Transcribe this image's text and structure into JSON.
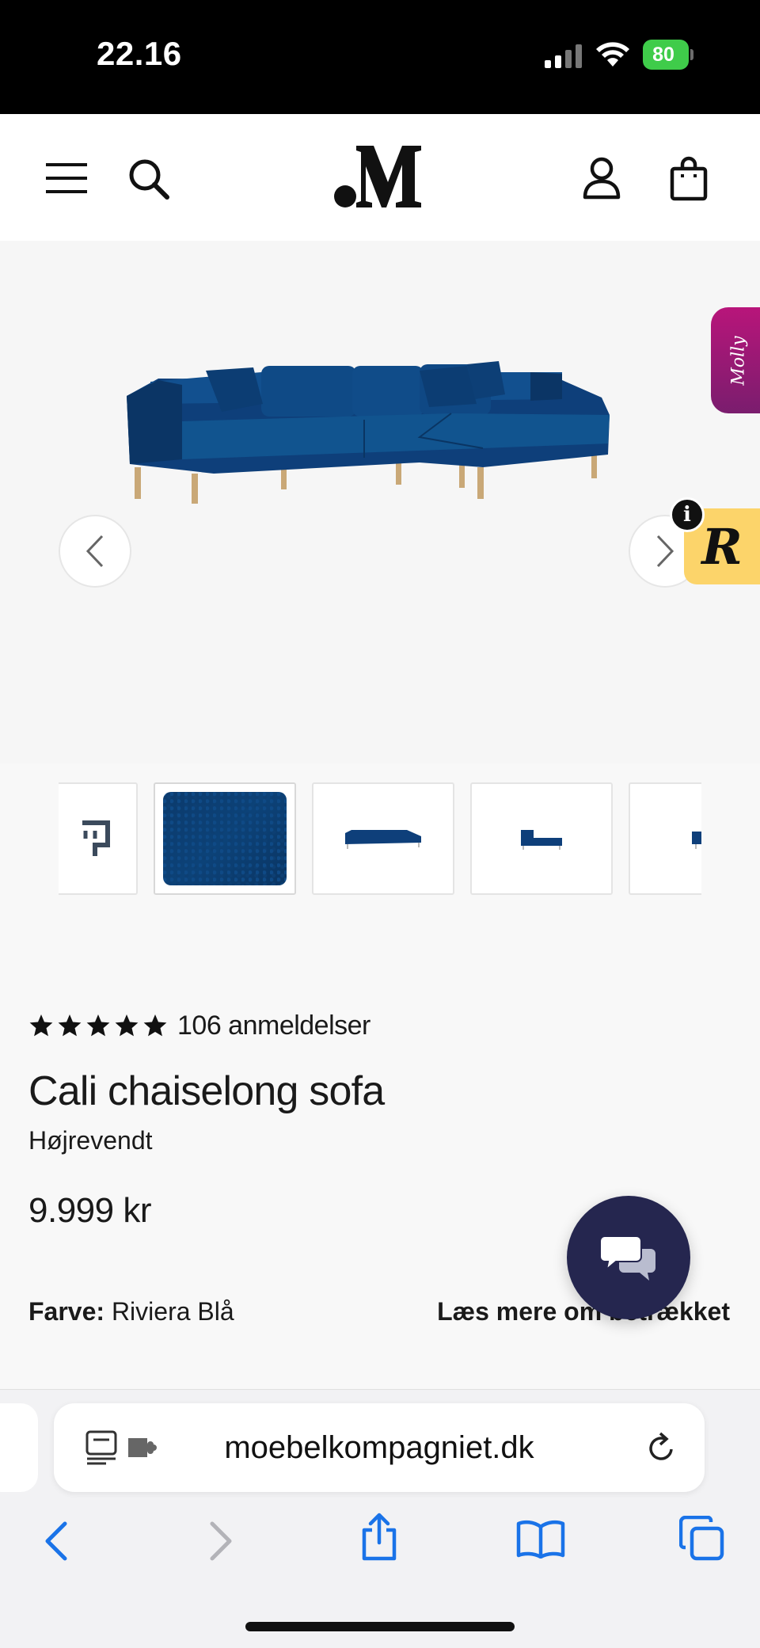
{
  "status_bar": {
    "time": "22.16",
    "battery": "80"
  },
  "header": {
    "menu_icon": "hamburger-icon",
    "search_icon": "search-icon",
    "logo_text": ".M",
    "account_icon": "user-icon",
    "cart_icon": "shopping-bag-icon"
  },
  "gallery": {
    "prev_icon": "chevron-left-icon",
    "next_icon": "chevron-right-icon",
    "molly_label": "Molly",
    "r_badge_label": "R",
    "info_label": "i",
    "sofa_color": "#0e3f7a"
  },
  "product": {
    "rating_stars": 5,
    "reviews": "106 anmeldelser",
    "title": "Cali chaiselong sofa",
    "variant": "Højrevendt",
    "price": "9.999 kr",
    "color_label": "Farve:",
    "color_value": "Riviera Blå",
    "read_more": "Læs mere om betrækket"
  },
  "browser": {
    "url": "moebelkompagniet.dk",
    "toolbar": [
      "back-icon",
      "forward-icon",
      "share-icon",
      "bookmarks-icon",
      "tabs-icon"
    ],
    "accent": "#1a73e8"
  }
}
